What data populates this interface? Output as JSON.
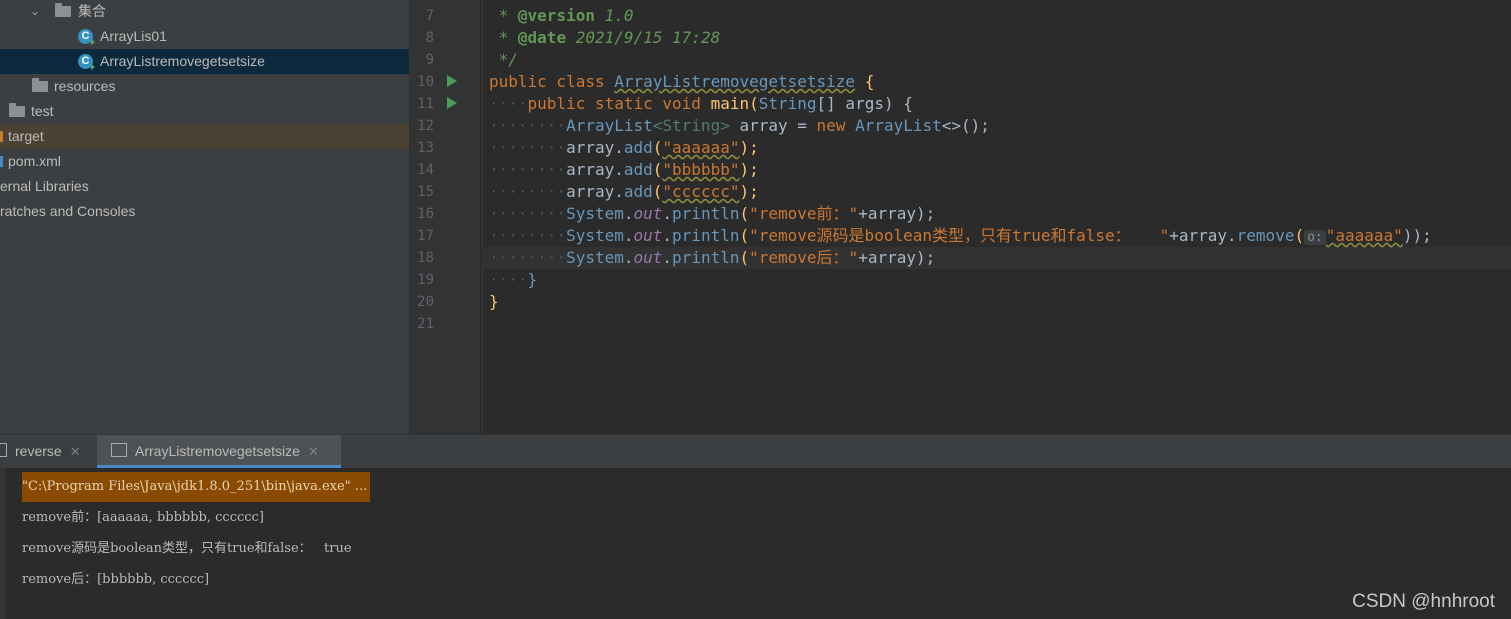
{
  "tree": {
    "folder_jihe": "集合",
    "class1": "ArrayLis01",
    "class2": "ArrayListremovegetsetsize",
    "resources": "resources",
    "test": "test",
    "target": "target",
    "pom": "pom.xml",
    "ext_libs": "ernal Libraries",
    "scratches": "ratches and Consoles"
  },
  "editor": {
    "line_numbers": [
      "7",
      "8",
      "9",
      "10",
      "11",
      "12",
      "13",
      "14",
      "15",
      "16",
      "17",
      "18",
      "19",
      "20",
      "21"
    ],
    "l7_star": " * ",
    "l7_tag": "@version",
    "l7_val": " 1.0",
    "l8_star": " * ",
    "l8_tag": "@date",
    "l8_val": " 2021/9/15 17:28",
    "l9": " */",
    "l10_kw": "public class ",
    "l10_name": "ArrayListremovegetsetsize",
    "l10_brace": " {",
    "l11_kw": "public static void ",
    "l11_fn": "main",
    "l11_open": "(",
    "l11_type": "String",
    "l11_rest": "[] args) {",
    "l12_t1": "ArrayList",
    "l12_t2": "<String>",
    "l12_var": " array = ",
    "l12_kw": "new ",
    "l12_t3": "ArrayList",
    "l12_end": "<>();",
    "l13_a": "array.",
    "l13_m": "add",
    "l13_o": "(",
    "l13_s": "\"aaaaaa\"",
    "l13_e": ");",
    "l14_a": "array.",
    "l14_m": "add",
    "l14_o": "(",
    "l14_s": "\"bbbbbb\"",
    "l14_e": ");",
    "l15_a": "array.",
    "l15_m": "add",
    "l15_o": "(",
    "l15_s": "\"cccccc\"",
    "l15_e": ");",
    "sys": "System",
    "dot": ".",
    "out": "out",
    "println": "println",
    "l16_s": "\"remove前：\"",
    "l16_e": "+array);",
    "l17_s": "\"remove源码是boolean类型，只有true和false：   \"",
    "l17_m": "+array.",
    "l17_rm": "remove",
    "l17_o": "(",
    "l17_hint": "o:",
    "l17_arg": "\"aaaaaa\"",
    "l17_e": "));",
    "l18_s": "\"remove后：\"",
    "l18_e": "+array);",
    "l19": "}",
    "l20": "}",
    "top_partial": "* ..."
  },
  "run": {
    "tab1": "reverse",
    "tab2": "ArrayListremovegetsetsize",
    "close": "✕",
    "cmd": "\"C:\\Program Files\\Java\\jdk1.8.0_251\\bin\\java.exe\" ...",
    "out1": "remove前：[aaaaaa, bbbbbb, cccccc]",
    "out2": "remove源码是boolean类型，只有true和false：   true",
    "out3": "remove后：[bbbbbb, cccccc]"
  },
  "watermark": "CSDN @hnhroot"
}
